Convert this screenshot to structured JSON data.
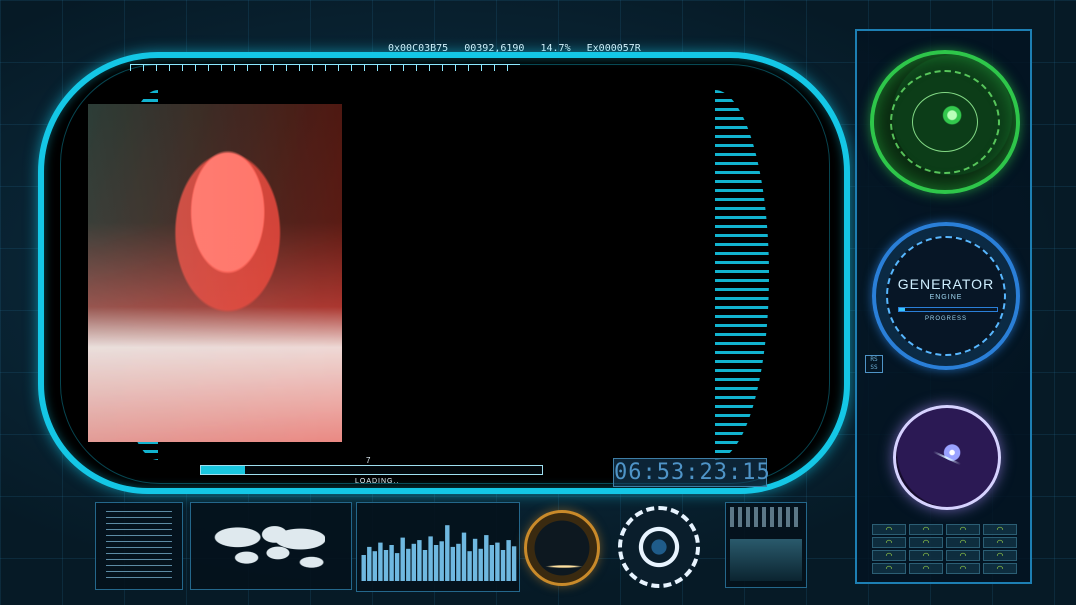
{
  "top_readout": {
    "hex_code": "0x00C03B75",
    "coords": "00392,6190",
    "percent": "14.7%",
    "ex_code": "Ex000057R"
  },
  "loading": {
    "value": "7",
    "label": "LOADING..",
    "progress_fraction": 0.13
  },
  "clock": {
    "time": "06:53:23:15"
  },
  "generator": {
    "title": "GENERATOR",
    "subtitle": "ENGINE",
    "progress_label": "PROGRESS",
    "progress_fraction": 0.06
  },
  "badge": {
    "line1": "RS",
    "line2": "SS"
  },
  "colors": {
    "accent": "#14c7e6",
    "radar": "#2ec64a",
    "generator": "#2a7fd8",
    "plasma": "#9aa2ff",
    "orange": "#c98a2a"
  },
  "bar_chart": {
    "values": [
      0.42,
      0.55,
      0.48,
      0.62,
      0.5,
      0.58,
      0.45,
      0.7,
      0.52,
      0.6,
      0.66,
      0.5,
      0.72,
      0.58,
      0.64,
      0.9,
      0.55,
      0.6,
      0.78,
      0.48,
      0.68,
      0.52,
      0.74,
      0.58,
      0.62,
      0.5,
      0.66,
      0.56
    ]
  },
  "indicators": [
    [
      "◠",
      "◠",
      "◠",
      "◠"
    ],
    [
      "◠",
      "◠",
      "◠",
      "◠"
    ],
    [
      "◠",
      "◠",
      "◠",
      "◠"
    ],
    [
      "◠",
      "◠",
      "◠",
      "◠"
    ]
  ]
}
